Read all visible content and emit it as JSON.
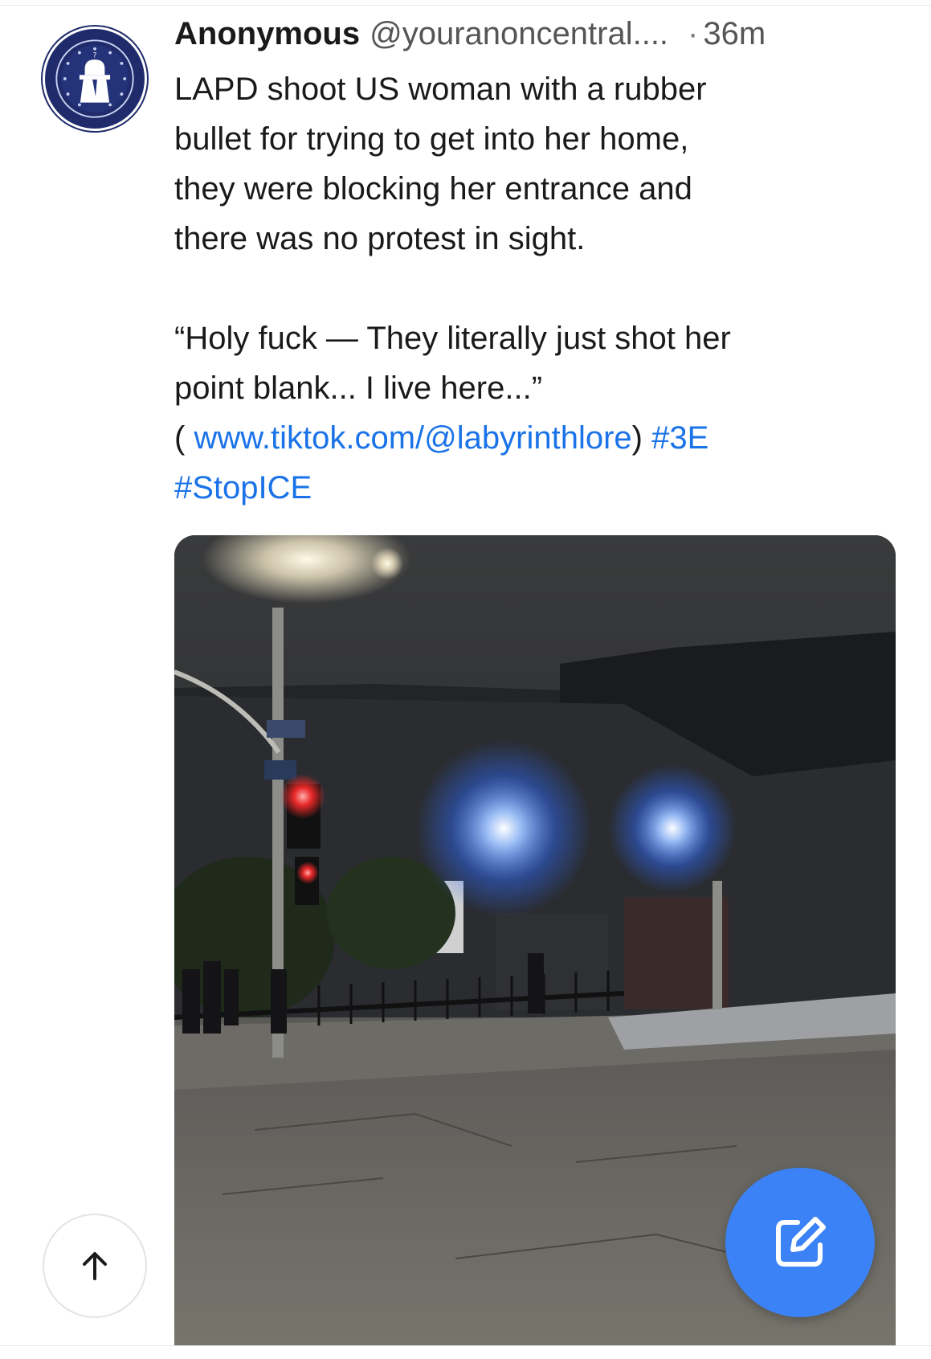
{
  "post": {
    "author": "Anonymous",
    "handle": "@youranoncentral....",
    "separator": "·",
    "time": "36m",
    "body_line1": "LAPD shoot US woman with a rubber",
    "body_line2": "bullet for trying to get into her home,",
    "body_line3": "they were blocking her entrance and",
    "body_line4": "there was no protest in sight.",
    "quote_line1": "“Holy fuck — They literally just shot her",
    "quote_line2": "point blank... I live here...”",
    "link_prefix": "( ",
    "link_text": "www.tiktok.com/@labyrinthlore",
    "link_suffix": ") ",
    "hashtag1": "#3E",
    "hashtag2": "#StopICE",
    "avatar_icon": "anonymous-emblem-icon",
    "media_description_icon": "video-thumbnail"
  },
  "controls": {
    "scroll_top_icon": "arrow-up-icon",
    "compose_icon": "compose-edit-icon"
  },
  "colors": {
    "link": "#1a73e8",
    "compose_button": "#3b82f6",
    "avatar_bg": "#1f2b6b"
  }
}
